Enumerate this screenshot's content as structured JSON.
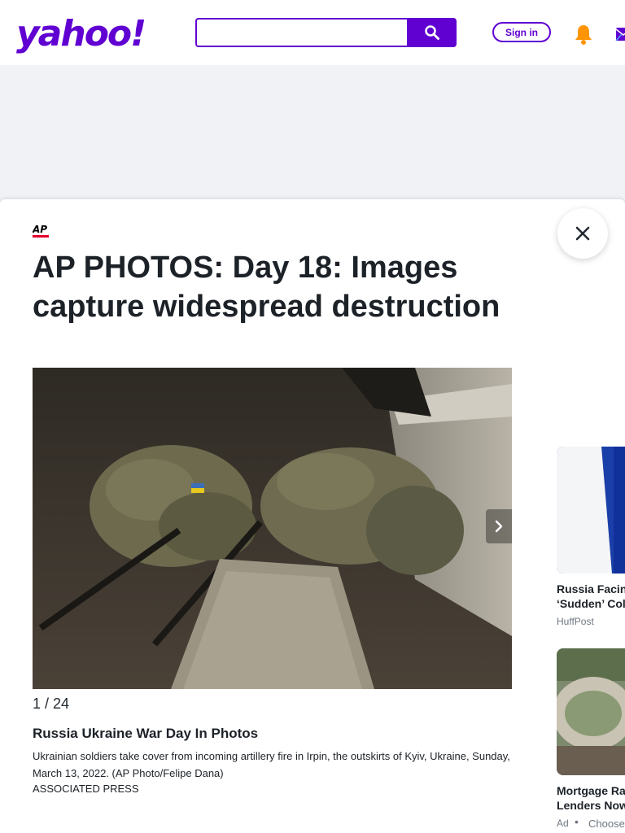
{
  "header": {
    "logo": "yahoo!",
    "search": {
      "placeholder": "",
      "value": ""
    },
    "signin_label": "Sign in",
    "colors": {
      "brand": "#6001d2",
      "bell": "#ff9500"
    },
    "icons": [
      "search-icon",
      "bell-icon",
      "mail-icon"
    ]
  },
  "article": {
    "source_logo": "AP",
    "title": "AP PHOTOS: Day 18: Images capture widespread destruction"
  },
  "slideshow": {
    "counter": "1 / 24",
    "caption_title": "Russia Ukraine War Day In Photos",
    "caption_text": "Ukrainian soldiers take cover from incoming artillery fire in Irpin, the outskirts of Kyiv, Ukraine, Sunday, March 13, 2022. (AP Photo/Felipe Dana)",
    "credit": "ASSOCIATED PRESS"
  },
  "sidebar": {
    "cards": [
      {
        "title_line1": "Russia Facin",
        "title_line2": "‘Sudden’ Col",
        "source": "HuffPost"
      },
      {
        "title_line1": "Mortgage Ra",
        "title_line2": "Lenders Now",
        "ad_label": "Ad",
        "source": "Choose"
      }
    ]
  }
}
